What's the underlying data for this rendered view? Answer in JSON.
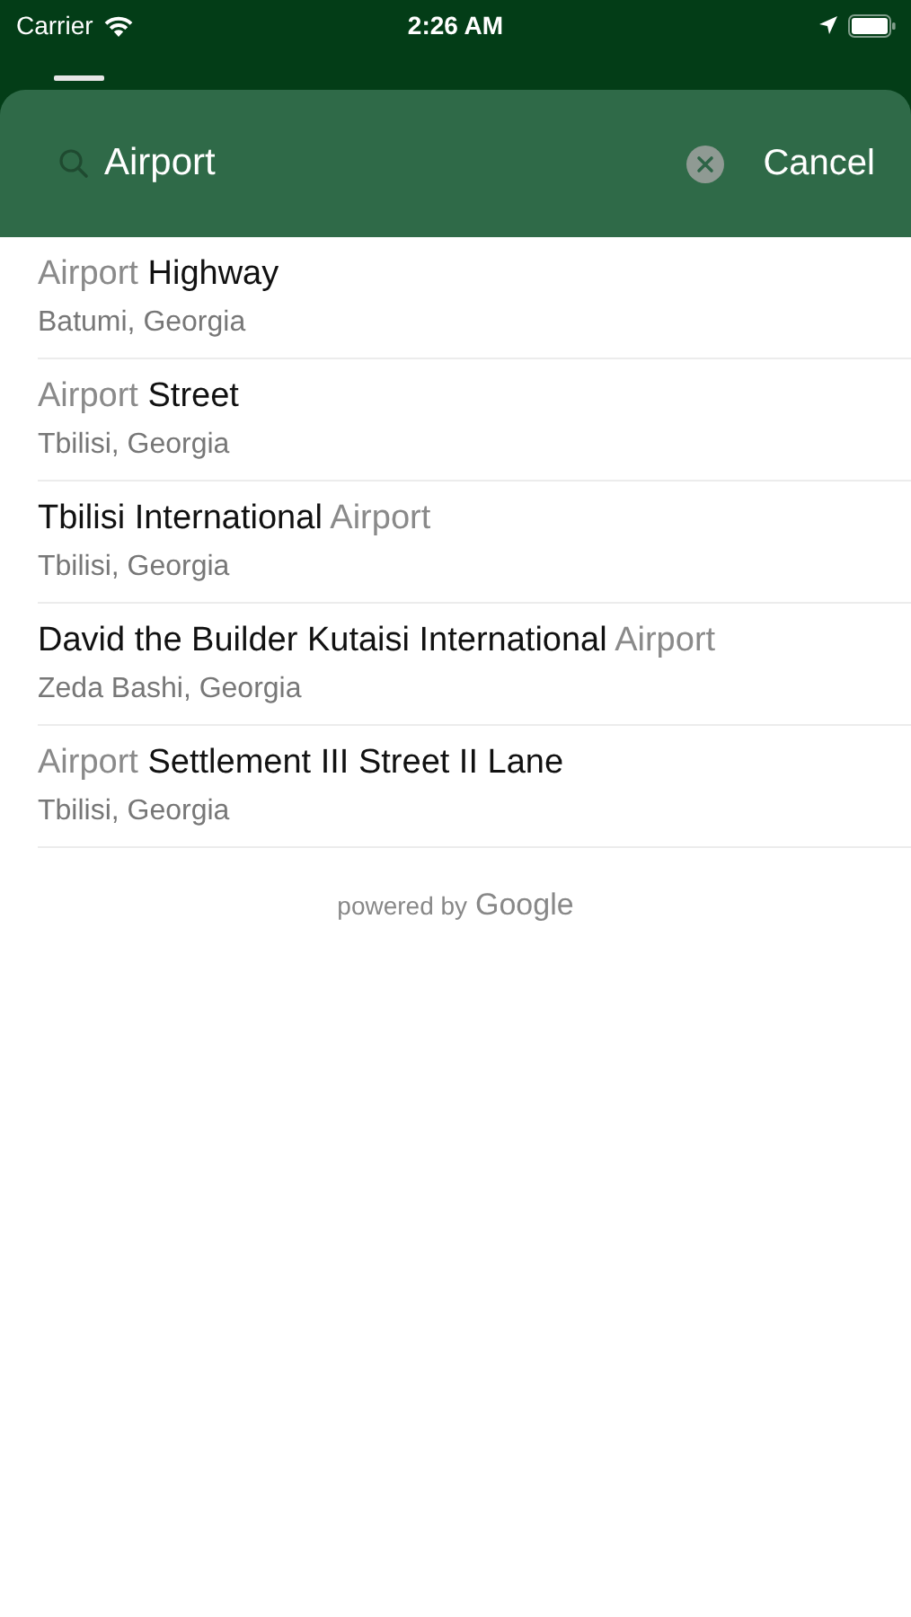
{
  "status_bar": {
    "carrier": "Carrier",
    "time": "2:26 AM"
  },
  "search": {
    "value": "Airport",
    "cancel": "Cancel"
  },
  "results": [
    {
      "title": [
        {
          "text": "Airport",
          "match": true
        },
        {
          "text": " Highway",
          "match": false
        }
      ],
      "subtitle": "Batumi, Georgia"
    },
    {
      "title": [
        {
          "text": "Airport",
          "match": true
        },
        {
          "text": " Street",
          "match": false
        }
      ],
      "subtitle": "Tbilisi, Georgia"
    },
    {
      "title": [
        {
          "text": "Tbilisi International",
          "match": false
        },
        {
          "text": " Airport",
          "match": true
        }
      ],
      "subtitle": "Tbilisi, Georgia"
    },
    {
      "title": [
        {
          "text": "David the Builder Kutaisi International",
          "match": false
        },
        {
          "text": " Airport",
          "match": true
        }
      ],
      "subtitle": "Zeda Bashi, Georgia"
    },
    {
      "title": [
        {
          "text": "Airport",
          "match": true
        },
        {
          "text": " Settlement III Street II Lane",
          "match": false
        }
      ],
      "subtitle": "Tbilisi, Georgia"
    }
  ],
  "attribution": {
    "prefix": "powered by",
    "brand": "Google"
  }
}
